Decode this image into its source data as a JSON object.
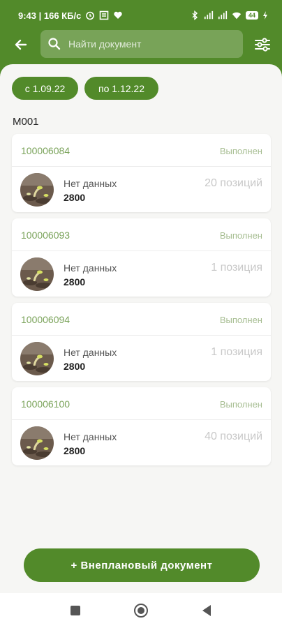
{
  "status_bar": {
    "time_info": "9:43 | 166 КБ/с",
    "battery": "44"
  },
  "header": {
    "search_placeholder": "Найти документ"
  },
  "filters": {
    "date_from": "с 1.09.22",
    "date_to": "по 1.12.22"
  },
  "group": {
    "title": "М001"
  },
  "documents": [
    {
      "number": "100006084",
      "status": "Выполнен",
      "description": "Нет данных",
      "value": "2800",
      "positions": "20 позиций"
    },
    {
      "number": "100006093",
      "status": "Выполнен",
      "description": "Нет данных",
      "value": "2800",
      "positions": "1 позиция"
    },
    {
      "number": "100006094",
      "status": "Выполнен",
      "description": "Нет данных",
      "value": "2800",
      "positions": "1 позиция"
    },
    {
      "number": "100006100",
      "status": "Выполнен",
      "description": "Нет данных",
      "value": "2800",
      "positions": "40 позиций"
    }
  ],
  "actions": {
    "add_document": "+ Внеплановый документ"
  },
  "colors": {
    "brand_green": "#528a2a",
    "document_number": "#7aa35a",
    "status_text": "#a6bd91",
    "background": "#f6f6f4"
  },
  "icons": {
    "back": "arrow-left-icon",
    "search": "search-icon",
    "filter": "sliders-icon",
    "nav_recent": "square-icon",
    "nav_home": "circle-icon",
    "nav_back": "triangle-back-icon"
  }
}
